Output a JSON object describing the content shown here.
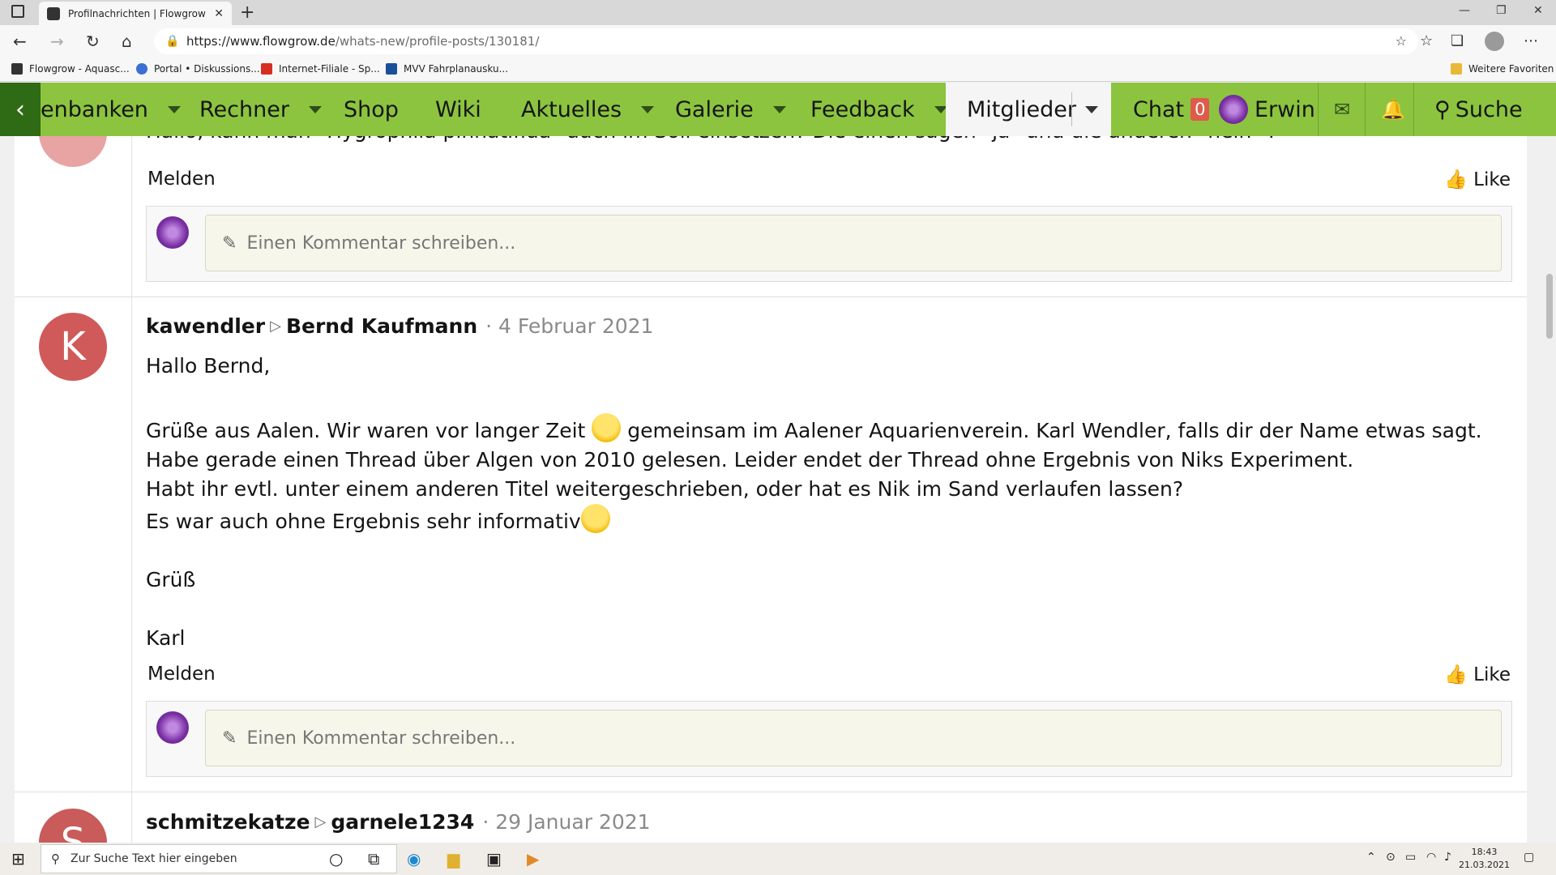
{
  "browser": {
    "tab_title": "Profilnachrichten | Flowgrow",
    "url_host": "https://www.flowgrow.de",
    "url_path": "/whats-new/profile-posts/130181/",
    "bookmarks": [
      {
        "label": "Flowgrow - Aquasc...",
        "color": "#333333"
      },
      {
        "label": "Portal • Diskussions...",
        "color": "#3b6fd4"
      },
      {
        "label": "Internet-Filiale - Sp...",
        "color": "#d62d20"
      },
      {
        "label": "MVV Fahrplanausku...",
        "color": "#1a4f9c"
      }
    ],
    "more_favorites": "Weitere Favoriten"
  },
  "sitenav": {
    "items": [
      "enbanken",
      "Rechner",
      "Shop",
      "Wiki",
      "Aktuelles",
      "Galerie",
      "Feedback"
    ],
    "active": "Mitglieder",
    "chat_label": "Chat",
    "chat_count": "0",
    "user_name": "Erwin",
    "search_label": "Suche"
  },
  "posts": {
    "top_text": "Hallo, kann man \"Hygrophila pinnatifida\" auch im Soil einsetzen? Die einen sagen \"ja\" und die anderen \"nein\" !",
    "melden": "Melden",
    "like": "Like",
    "comment_placeholder": "Einen Kommentar schreiben...",
    "post2": {
      "avatar_letter": "K",
      "avatar_color": "#d05a5a",
      "author": "kawendler",
      "recipient": "Bernd Kaufmann",
      "date": "4 Februar 2021",
      "line1": "Hallo Bernd,",
      "line2a": "Grüße aus Aalen. Wir waren vor langer Zeit",
      "line2b": "gemeinsam im Aalener Aquarienverein. Karl Wendler, falls dir der Name etwas sagt.",
      "line3": "Habe gerade einen Thread über Algen von 2010 gelesen. Leider endet der Thread ohne Ergebnis von Niks Experiment.",
      "line4": "Habt ihr evtl. unter einem anderen Titel weitergeschrieben, oder hat es Nik im Sand verlaufen lassen?",
      "line5": "Es war auch ohne Ergebnis sehr informativ",
      "line6": "Grüß",
      "line7": "Karl"
    },
    "post3": {
      "avatar_letter": "S",
      "avatar_color": "#c95b5b",
      "author": "schmitzekatze",
      "recipient": "garnele1234",
      "date": "29 Januar 2021"
    }
  },
  "taskbar": {
    "search_placeholder": "Zur Suche Text hier eingeben",
    "time": "18:43",
    "date": "21.03.2021"
  }
}
